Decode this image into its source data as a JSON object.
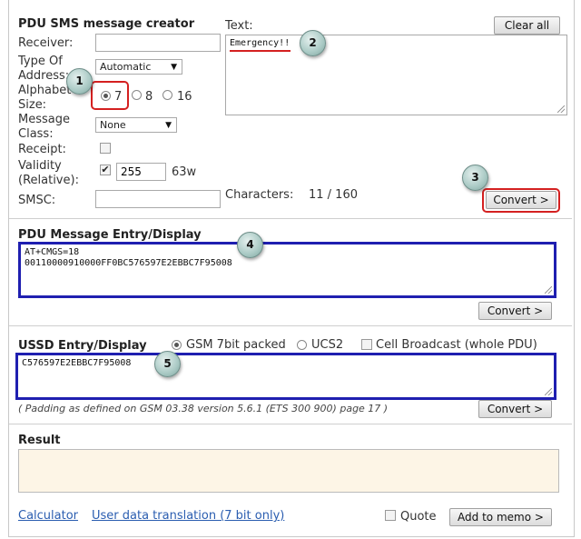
{
  "sms_creator": {
    "title": "PDU SMS message creator",
    "receiver_label": "Receiver:",
    "receiver_value": "",
    "type_of_address_label_1": "Type Of",
    "type_of_address_label_2": "Address:",
    "type_of_address_value": "Automatic",
    "alphabet_label_1": "Alphabet",
    "alphabet_label_2": "Size:",
    "alphabet_options": [
      "7",
      "8",
      "16"
    ],
    "alphabet_selected": "7",
    "message_class_label_1": "Message",
    "message_class_label_2": "Class:",
    "message_class_value": "None",
    "receipt_label": "Receipt:",
    "validity_label_1": "Validity",
    "validity_label_2": "(Relative):",
    "validity_checked": true,
    "validity_value": "255",
    "validity_unit": "63w",
    "smsc_label": "SMSC:",
    "smsc_value": "",
    "text_label": "Text:",
    "text_value": "Emergency!!",
    "clear_all_label": "Clear all",
    "characters_label": "Characters:",
    "characters_count": "11 / 160",
    "convert_label": "Convert >"
  },
  "pdu_display": {
    "title": "PDU Message Entry/Display",
    "content_line1": "AT+CMGS=18",
    "content_line2": "00110000910000FF0BC576597E2EBBC7F95008",
    "convert_label": "Convert >"
  },
  "ussd": {
    "title": "USSD Entry/Display",
    "options": [
      "GSM 7bit packed",
      "UCS2"
    ],
    "selected": "GSM 7bit packed",
    "cell_broadcast_label": "Cell Broadcast (whole PDU)",
    "content": "C576597E2EBBC7F95008",
    "padding_note": "( Padding as defined on GSM 03.38 version 5.6.1 (ETS 300 900) page 17 )",
    "convert_label": "Convert >"
  },
  "result": {
    "title": "Result",
    "content": ""
  },
  "footer": {
    "calculator_link": "Calculator",
    "user_data_link": "User data translation (7 bit only)",
    "quote_label": "Quote",
    "memo_button": "Add to memo >"
  },
  "annotations": [
    "1",
    "2",
    "3",
    "4",
    "5"
  ],
  "colors": {
    "highlight_red": "#d42020",
    "highlight_blue": "#1f1fb0",
    "result_bg": "#fdf5e6",
    "link": "#2a5db0"
  }
}
